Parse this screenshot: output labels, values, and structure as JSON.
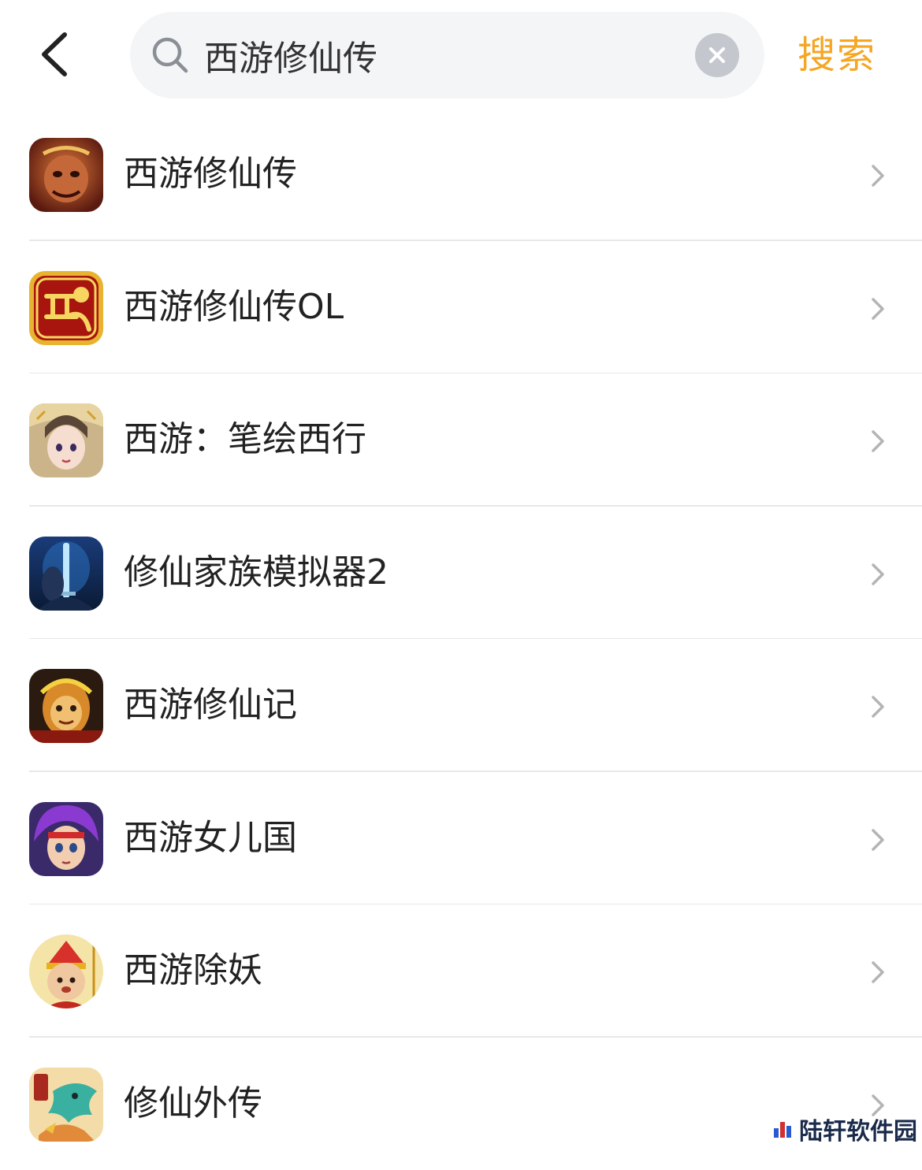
{
  "header": {
    "back_icon": "chevron-left-icon",
    "search": {
      "value": "西游修仙传",
      "icon": "search-icon",
      "clear_icon": "clear-icon"
    },
    "search_button": "搜索",
    "accent_color": "#f5a623"
  },
  "results": [
    {
      "title": "西游修仙传",
      "icon": "monkey-king-app-icon"
    },
    {
      "title": "西游修仙传OL",
      "icon": "xiyou-gold-app-icon"
    },
    {
      "title": "西游：笔绘西行",
      "icon": "anime-girl-app-icon"
    },
    {
      "title": "修仙家族模拟器2",
      "icon": "sword-warrior-app-icon"
    },
    {
      "title": "西游修仙记",
      "icon": "golden-monkey-app-icon"
    },
    {
      "title": "西游女儿国",
      "icon": "purple-hair-hero-app-icon"
    },
    {
      "title": "西游除妖",
      "icon": "monk-cartoon-app-icon"
    },
    {
      "title": "修仙外传",
      "icon": "dragon-cartoon-app-icon"
    }
  ],
  "watermark": {
    "text": "陆轩软件园"
  }
}
